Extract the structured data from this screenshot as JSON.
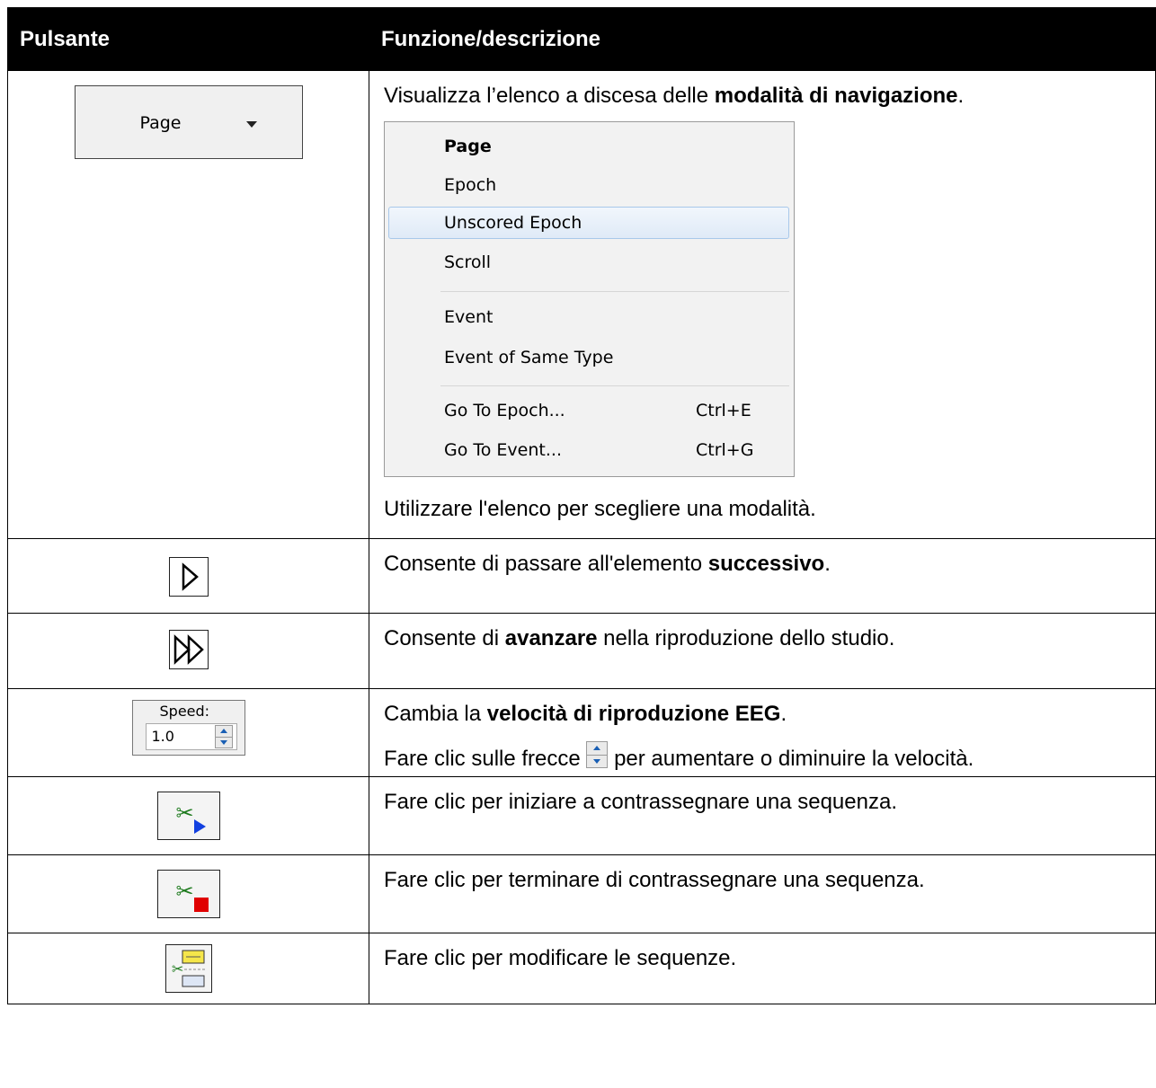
{
  "table": {
    "header_button": "Pulsante",
    "header_function": "Funzione/descrizione"
  },
  "rows": {
    "nav_mode": {
      "button_label": "Page",
      "desc_prefix": "Visualizza l’elenco a discesa delle ",
      "desc_bold": "modalità di navigazione",
      "desc_suffix": ".",
      "menu": {
        "items": [
          "Page",
          "Epoch",
          "Unscored Epoch",
          "Scroll",
          "Event",
          "Event of Same Type",
          "Go To Epoch...",
          "Go To Event..."
        ],
        "shortcuts": [
          "Ctrl+E",
          "Ctrl+G"
        ]
      },
      "note": "Utilizzare l'elenco per scegliere una modalità."
    },
    "next": {
      "desc_prefix": "Consente di passare all'elemento ",
      "desc_bold": "successivo",
      "desc_suffix": "."
    },
    "fast_forward": {
      "desc_prefix": "Consente di ",
      "desc_bold": "avanzare",
      "desc_suffix": " nella riproduzione dello studio."
    },
    "speed": {
      "label": "Speed:",
      "value": "1.0",
      "desc_prefix": "Cambia la ",
      "desc_bold": "velocità di riproduzione EEG",
      "desc_suffix": ".",
      "note_prefix": "Fare clic sulle frecce ",
      "note_suffix": " per aumentare o diminuire la velocità."
    },
    "seq_start": {
      "desc": "Fare clic per iniziare a contrassegnare una sequenza."
    },
    "seq_end": {
      "desc": "Fare clic per terminare di contrassegnare una sequenza."
    },
    "seq_edit": {
      "desc": "Fare clic per modificare le sequenze."
    }
  },
  "colors": {
    "header_bg": "#000000",
    "menu_highlight": "#dfeaf7",
    "play_blue": "#1240e0",
    "stop_red": "#e00000"
  },
  "icons": [
    "dropdown-arrow-icon",
    "play-next-icon",
    "fast-forward-icon",
    "spinner-arrows-icon",
    "scissors-start-icon",
    "scissors-stop-icon",
    "edit-sequences-icon"
  ]
}
